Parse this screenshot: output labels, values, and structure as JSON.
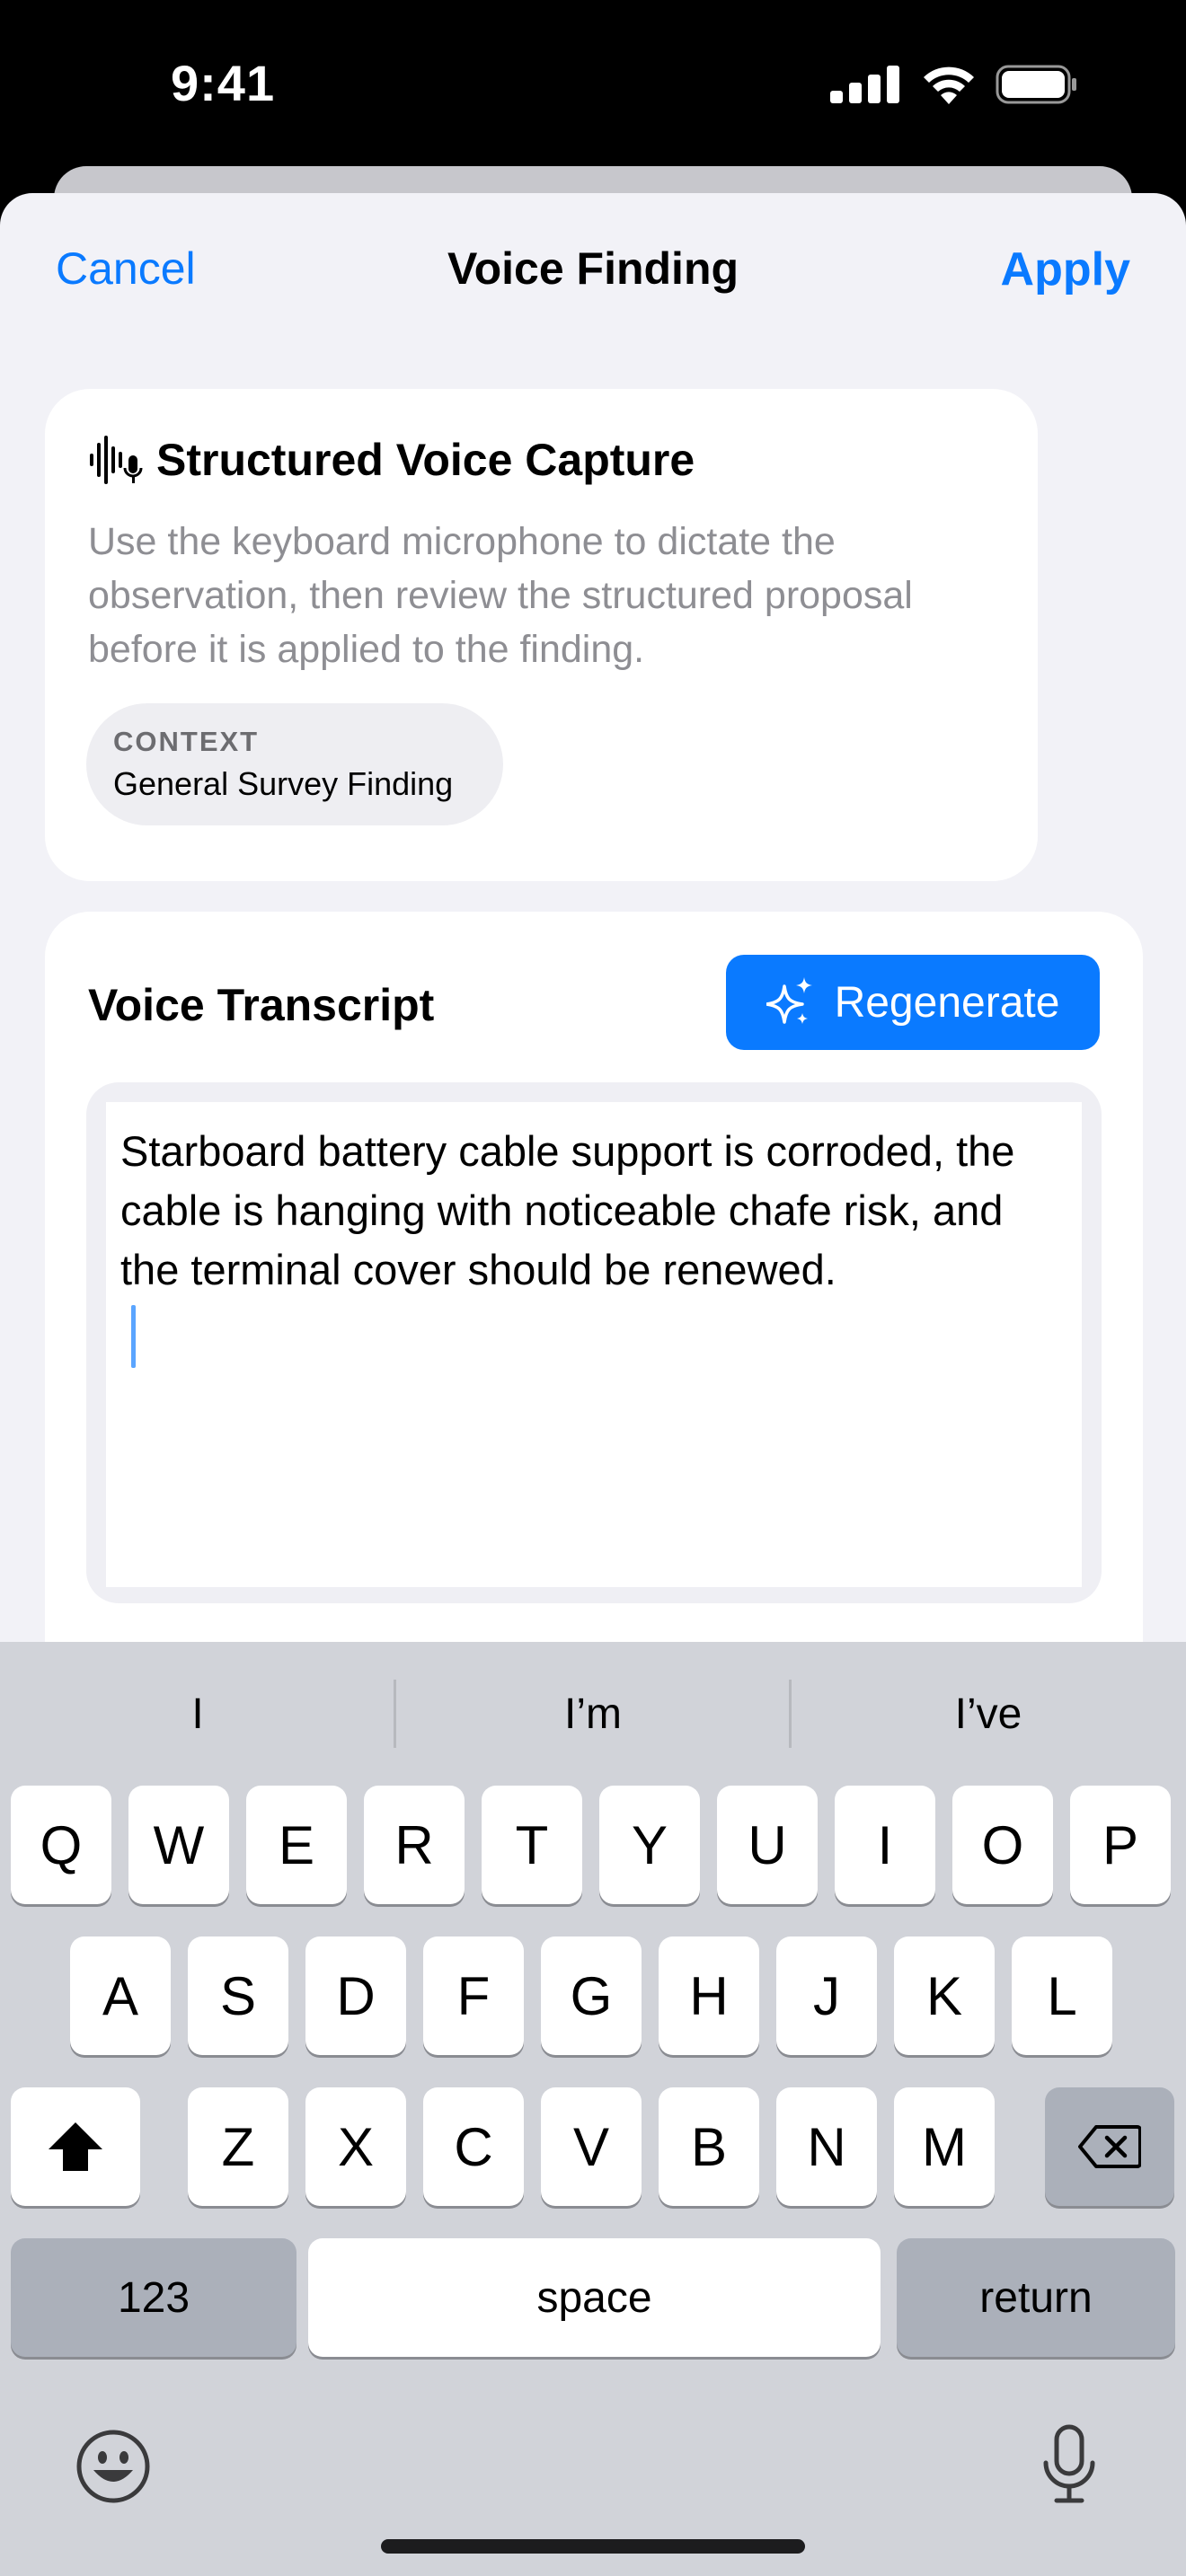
{
  "status_bar": {
    "time": "9:41"
  },
  "nav": {
    "cancel_label": "Cancel",
    "title": "Voice Finding",
    "apply_label": "Apply"
  },
  "capture_card": {
    "icon": "waveform-mic-icon",
    "title": "Structured Voice Capture",
    "description": "Use the keyboard microphone to dictate the observation, then review the structured proposal before it is applied to the finding.",
    "context_label": "CONTEXT",
    "context_value": "General Survey Finding"
  },
  "transcript_card": {
    "title": "Voice Transcript",
    "regenerate_label": "Regenerate",
    "regenerate_icon": "sparkles-icon",
    "text": "Starboard battery cable support is corroded, the cable is hanging with noticeable chafe risk, and the terminal cover should be renewed."
  },
  "keyboard": {
    "suggestions": [
      "I",
      "I’m",
      "I’ve"
    ],
    "row1": [
      "Q",
      "W",
      "E",
      "R",
      "T",
      "Y",
      "U",
      "I",
      "O",
      "P"
    ],
    "row2": [
      "A",
      "S",
      "D",
      "F",
      "G",
      "H",
      "J",
      "K",
      "L"
    ],
    "row3": [
      "Z",
      "X",
      "C",
      "V",
      "B",
      "N",
      "M"
    ],
    "numbers_label": "123",
    "space_label": "space",
    "return_label": "return"
  },
  "colors": {
    "accent": "#0a7aff",
    "sheet_bg": "#f2f2f7",
    "keyboard_bg": "#d1d3d9"
  }
}
